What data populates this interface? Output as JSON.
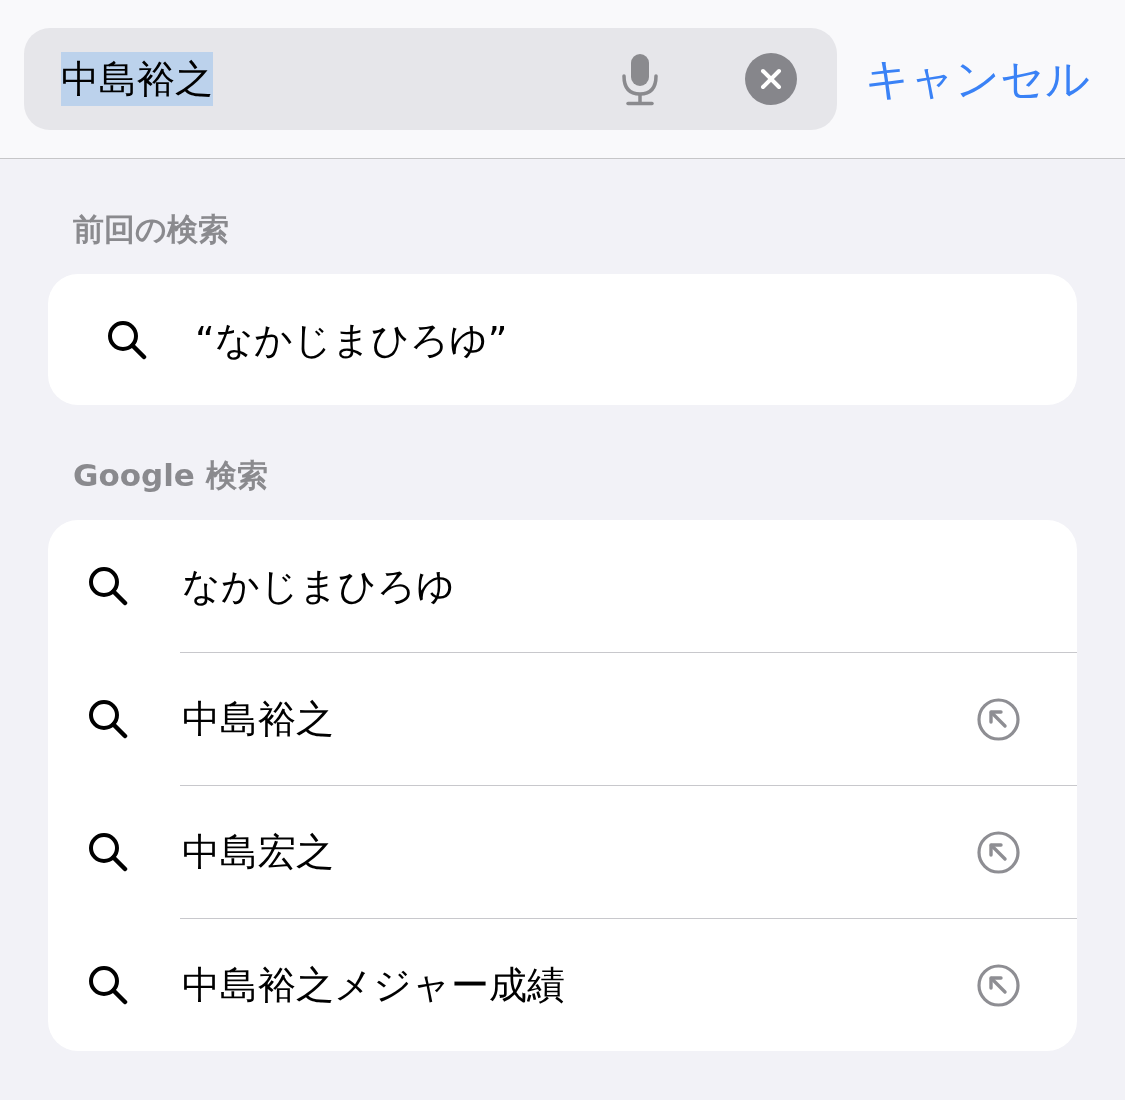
{
  "search_bar": {
    "value": "中島裕之",
    "text_selected": true,
    "cancel_label": "キャンセル"
  },
  "sections": [
    {
      "title": "前回の検索",
      "kind": "recent",
      "items": [
        {
          "text": "“なかじまひろゆ”",
          "fill_button": false
        }
      ]
    },
    {
      "title": "Google 検索",
      "kind": "suggestions",
      "items": [
        {
          "text": "なかじまひろゆ",
          "fill_button": false
        },
        {
          "text": "中島裕之",
          "fill_button": true
        },
        {
          "text": "中島宏之",
          "fill_button": true
        },
        {
          "text": "中島裕之メジャー成績",
          "fill_button": true
        }
      ]
    }
  ]
}
